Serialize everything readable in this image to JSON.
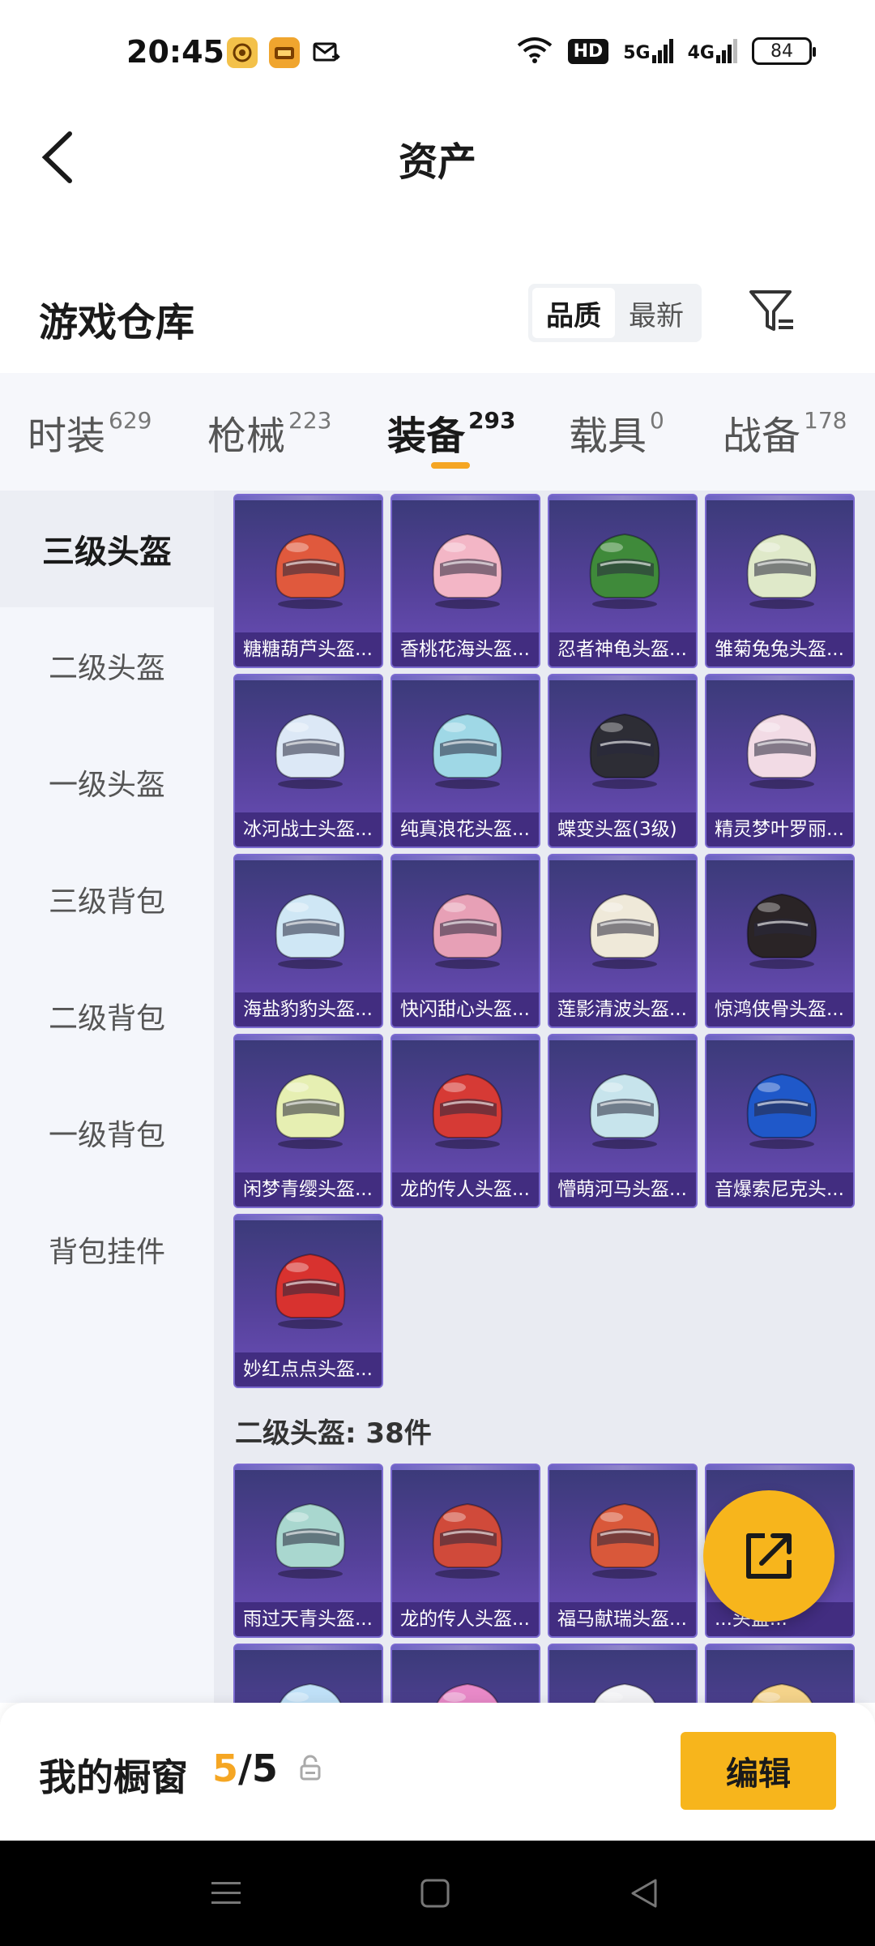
{
  "status_bar": {
    "time": "20:45",
    "hd": "HD",
    "net1": "5G",
    "net2": "4G",
    "battery": "84"
  },
  "header": {
    "title": "资产"
  },
  "warehouse": {
    "title": "游戏仓库",
    "sort_options": [
      "品质",
      "最新"
    ],
    "sort_active": "品质"
  },
  "tabs": [
    {
      "label": "时装",
      "count": "629"
    },
    {
      "label": "枪械",
      "count": "223"
    },
    {
      "label": "装备",
      "count": "293"
    },
    {
      "label": "载具",
      "count": "0"
    },
    {
      "label": "战备",
      "count": "178"
    }
  ],
  "active_tab": "装备",
  "sidebar": [
    {
      "label": "三级头盔"
    },
    {
      "label": "二级头盔"
    },
    {
      "label": "一级头盔"
    },
    {
      "label": "三级背包"
    },
    {
      "label": "二级背包"
    },
    {
      "label": "一级背包"
    },
    {
      "label": "背包挂件"
    }
  ],
  "items_lvl3": [
    {
      "name": "糖糖葫芦头盔...",
      "color": "#e0593d"
    },
    {
      "name": "香桃花海头盔...",
      "color": "#f3b6c6"
    },
    {
      "name": "忍者神龟头盔...",
      "color": "#3f8a3a"
    },
    {
      "name": "雏菊兔兔头盔...",
      "color": "#dfe9c9"
    },
    {
      "name": "冰河战士头盔...",
      "color": "#dce8f6"
    },
    {
      "name": "纯真浪花头盔...",
      "color": "#9fd8e6"
    },
    {
      "name": "蝶变头盔(3级)",
      "color": "#2d2d35"
    },
    {
      "name": "精灵梦叶罗丽...",
      "color": "#f2dbe5"
    },
    {
      "name": "海盐豹豹头盔...",
      "color": "#cfe7f5"
    },
    {
      "name": "快闪甜心头盔...",
      "color": "#e7a0b6"
    },
    {
      "name": "莲影清波头盔...",
      "color": "#efe9d9"
    },
    {
      "name": "惊鸿侠骨头盔...",
      "color": "#2a2426"
    },
    {
      "name": "闲梦青缨头盔...",
      "color": "#e6efb2"
    },
    {
      "name": "龙的传人头盔...",
      "color": "#d63a35"
    },
    {
      "name": "懵萌河马头盔...",
      "color": "#c7e4ec"
    },
    {
      "name": "音爆索尼克头...",
      "color": "#1f58c9"
    },
    {
      "name": "妙红点点头盔...",
      "color": "#d8322f"
    }
  ],
  "section_lvl2": "二级头盔: 38件",
  "items_lvl2": [
    {
      "name": "雨过天青头盔...",
      "color": "#a9d7cf"
    },
    {
      "name": "龙的传人头盔...",
      "color": "#d04a3a"
    },
    {
      "name": "福马献瑞头盔...",
      "color": "#d9583a"
    },
    {
      "name": "...头盔...",
      "color": "#c6d7f0"
    }
  ],
  "items_lvl2_peek": [
    {
      "color": "#bfe0f7"
    },
    {
      "color": "#e889c8"
    },
    {
      "color": "#f2f2f5"
    },
    {
      "color": "#f4d38a"
    }
  ],
  "showcase": {
    "title": "我的橱窗",
    "current": "5",
    "sep": "/",
    "total": "5",
    "edit_label": "编辑"
  }
}
